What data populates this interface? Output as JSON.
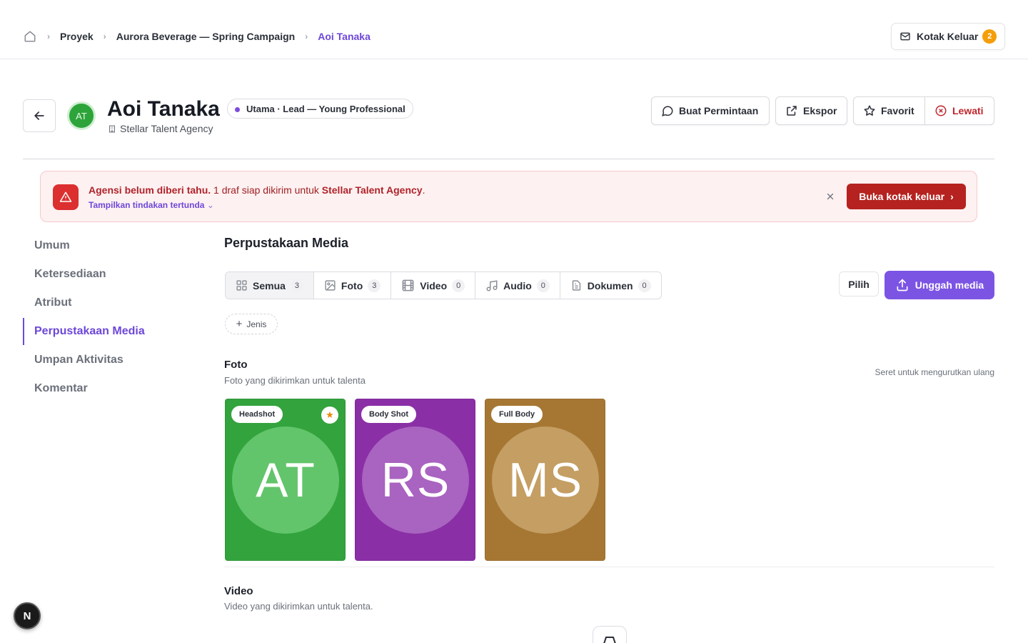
{
  "breadcrumb": {
    "items": [
      "Proyek",
      "Aurora Beverage — Spring Campaign",
      "Aoi Tanaka"
    ]
  },
  "topbar": {
    "outbox_label": "Kotak Keluar",
    "outbox_count": "2"
  },
  "profile": {
    "avatar_initials": "AT",
    "name": "Aoi Tanaka",
    "role": "Utama · Lead — Young Professional",
    "agency": "Stellar Talent Agency"
  },
  "actions": {
    "request": "Buat Permintaan",
    "export": "Ekspor",
    "favorite": "Favorit",
    "skip": "Lewati"
  },
  "alert": {
    "title": "Agensi belum diberi tahu.",
    "message": "1 draf siap dikirim untuk",
    "agency": "Stellar Talent Agency",
    "suffix": ".",
    "pending_link": "Tampilkan tindakan tertunda",
    "open_button": "Buka kotak keluar"
  },
  "sidebar": {
    "items": [
      {
        "label": "Umum"
      },
      {
        "label": "Ketersediaan"
      },
      {
        "label": "Atribut"
      },
      {
        "label": "Perpustakaan Media"
      },
      {
        "label": "Umpan Aktivitas"
      },
      {
        "label": "Komentar"
      }
    ],
    "active_index": 3
  },
  "media": {
    "title": "Perpustakaan Media",
    "tabs": [
      {
        "label": "Semua",
        "count": "3",
        "icon": "grid-icon"
      },
      {
        "label": "Foto",
        "count": "3",
        "icon": "image-icon"
      },
      {
        "label": "Video",
        "count": "0",
        "icon": "film-icon"
      },
      {
        "label": "Audio",
        "count": "0",
        "icon": "music-icon"
      },
      {
        "label": "Dokumen",
        "count": "0",
        "icon": "document-icon"
      }
    ],
    "select_label": "Pilih",
    "upload_label": "Unggah media",
    "add_type_label": "Jenis",
    "reorder_hint": "Seret untuk mengurutkan ulang",
    "photo_group": {
      "title": "Foto",
      "subtitle": "Foto yang dikirimkan untuk talenta",
      "cards": [
        {
          "tag": "Headshot",
          "initials": "AT",
          "bg": "#33a33d",
          "circle": "#62c56b",
          "starred": true
        },
        {
          "tag": "Body Shot",
          "initials": "RS",
          "bg": "#8a2fa6",
          "circle": "#a963c0",
          "starred": false
        },
        {
          "tag": "Full Body",
          "initials": "MS",
          "bg": "#a67733",
          "circle": "#c49e63",
          "starred": false
        }
      ]
    },
    "video_group": {
      "title": "Video",
      "subtitle": "Video yang dikirimkan untuk talenta."
    }
  },
  "fab_label": "N",
  "colors": {
    "accent": "#6d47d9",
    "danger": "#b5221f",
    "badge": "#f59e0b"
  }
}
